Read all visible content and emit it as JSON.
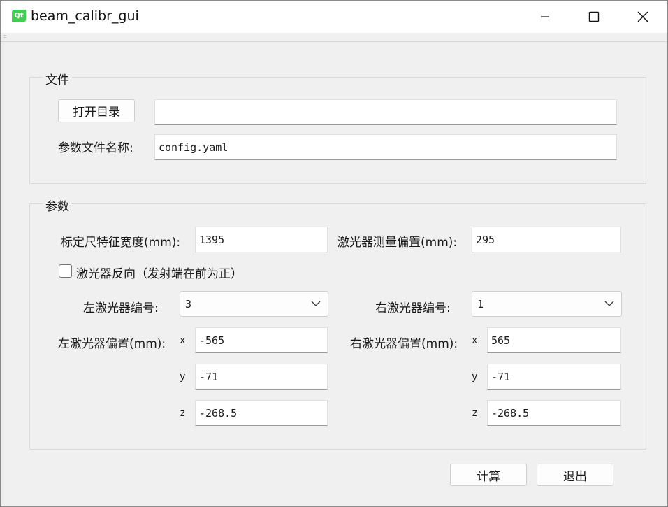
{
  "window": {
    "title": "beam_calibr_gui",
    "logo": "Qt"
  },
  "file_group": {
    "title": "文件",
    "open_dir_button": "打开目录",
    "dir_path_value": "",
    "param_file_label": "参数文件名称:",
    "param_file_value": "config.yaml"
  },
  "param_group": {
    "title": "参数",
    "scale_width_label": "标定尺特征宽度(mm):",
    "scale_width_value": "1395",
    "laser_offset_label": "激光器测量偏置(mm):",
    "laser_offset_value": "295",
    "reverse_label": "激光器反向（发射端在前为正）",
    "reverse_checked": false,
    "left_id_label": "左激光器编号:",
    "left_id_value": "3",
    "right_id_label": "右激光器编号:",
    "right_id_value": "1",
    "left_offset_label": "左激光器偏置(mm):",
    "right_offset_label": "右激光器偏置(mm):",
    "axis_x": "x",
    "axis_y": "y",
    "axis_z": "z",
    "left_x": "-565",
    "left_y": "-71",
    "left_z": "-268.5",
    "right_x": "565",
    "right_y": "-71",
    "right_z": "-268.5"
  },
  "buttons": {
    "compute": "计算",
    "exit": "退出"
  }
}
